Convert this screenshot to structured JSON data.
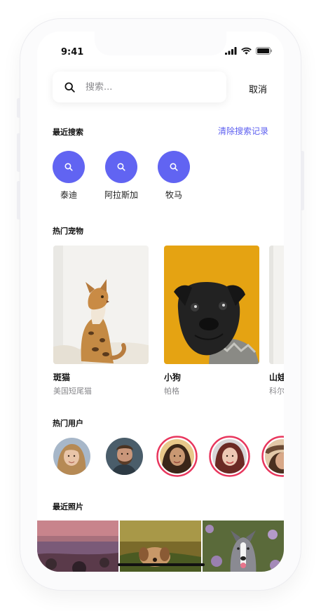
{
  "status": {
    "time": "9:41"
  },
  "search": {
    "placeholder": "搜索...",
    "cancel_label": "取消"
  },
  "recent_searches": {
    "title": "最近搜索",
    "clear_label": "清除搜索记录",
    "items": [
      {
        "label": "泰迪"
      },
      {
        "label": "阿拉斯加"
      },
      {
        "label": "牧马"
      }
    ]
  },
  "hot_pets": {
    "title": "热门宠物",
    "items": [
      {
        "name": "斑猫",
        "breed": "美国短尾猫"
      },
      {
        "name": "小狗",
        "breed": "帕格"
      },
      {
        "name": "山娃",
        "breed": "科尔"
      }
    ]
  },
  "hot_users": {
    "title": "热门用户"
  },
  "recent_photos": {
    "title": "最近照片"
  },
  "colors": {
    "accent": "#6164f2",
    "story_ring": "#e8365d",
    "pug_bg": "#e5a312"
  }
}
